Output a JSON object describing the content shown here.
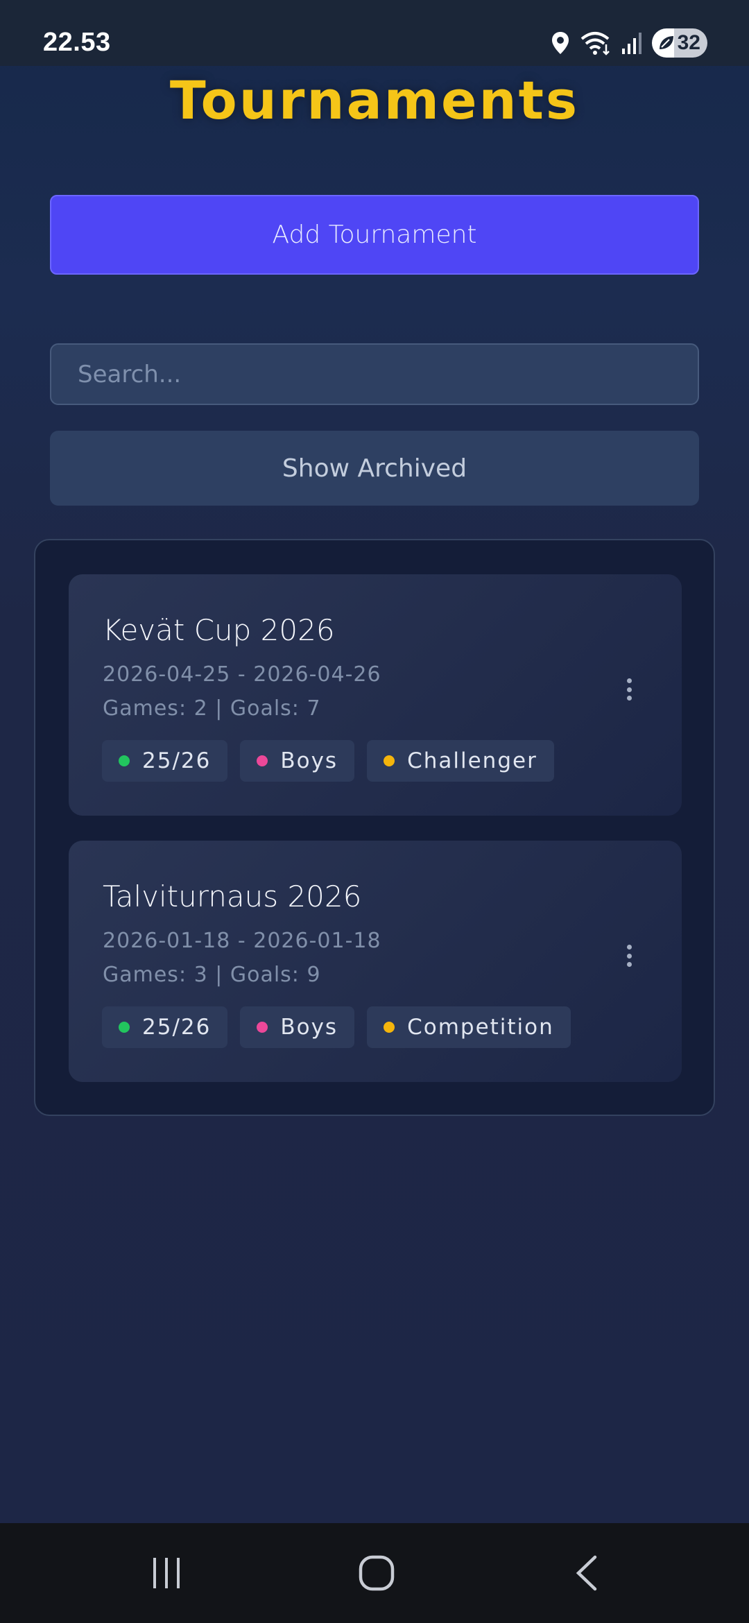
{
  "status_bar": {
    "time": "22.53",
    "battery": "32",
    "icons": [
      "location-icon",
      "wifi-icon",
      "signal-icon",
      "battery-icon"
    ]
  },
  "header": {
    "title": "Tournaments"
  },
  "actions": {
    "add_label": "Add Tournament",
    "search_placeholder": "Search...",
    "archived_label": "Show Archived"
  },
  "tournaments": [
    {
      "title": "Kevät Cup 2026",
      "dates": "2026-04-25 - 2026-04-26",
      "stats": "Games: 2 | Goals: 7",
      "tags": [
        {
          "label": "25/26",
          "color": "#22c55e"
        },
        {
          "label": "Boys",
          "color": "#ec4899"
        },
        {
          "label": "Challenger",
          "color": "#f5b50c"
        }
      ]
    },
    {
      "title": "Talviturnaus 2026",
      "dates": "2026-01-18 - 2026-01-18",
      "stats": "Games: 3 | Goals: 9",
      "tags": [
        {
          "label": "25/26",
          "color": "#22c55e"
        },
        {
          "label": "Boys",
          "color": "#ec4899"
        },
        {
          "label": "Competition",
          "color": "#f5b50c"
        }
      ]
    }
  ],
  "nav": [
    "recent-apps-icon",
    "home-icon",
    "back-icon"
  ],
  "colors": {
    "accent": "#f5c518",
    "primary_button": "#4f46f5",
    "background": "#1e2745"
  }
}
